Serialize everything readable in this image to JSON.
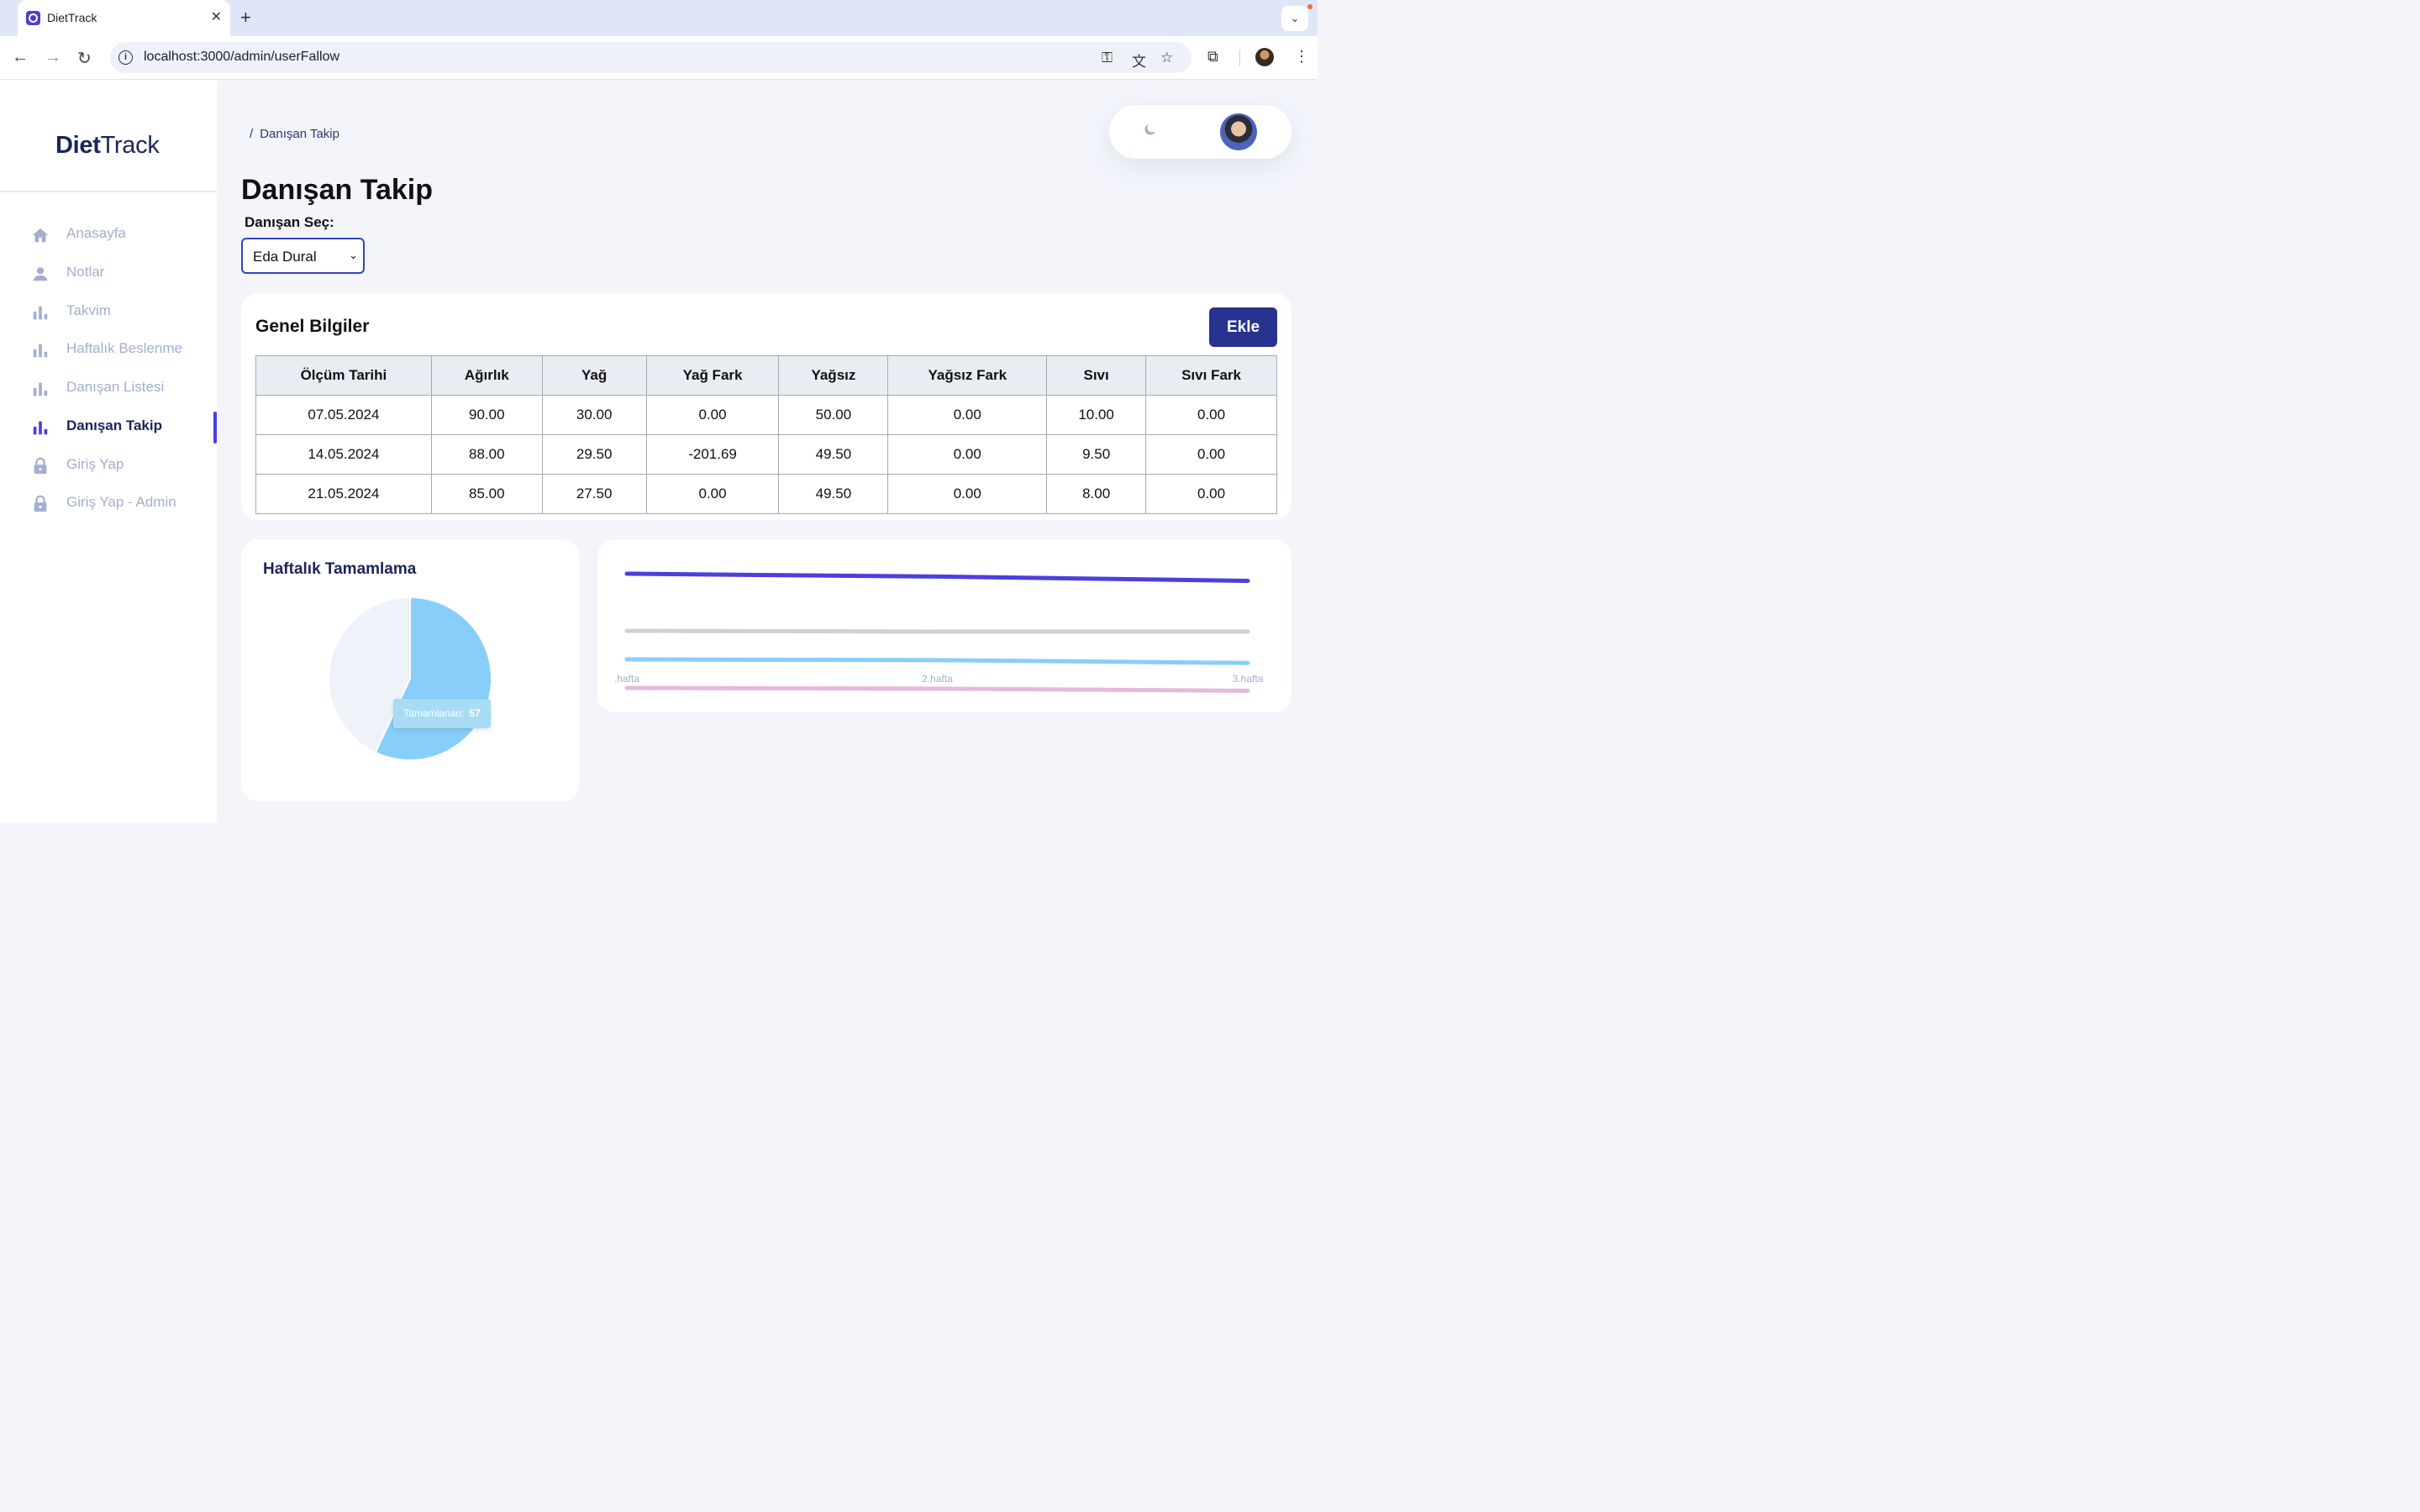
{
  "browser": {
    "tab_title": "DietTrack",
    "url": "localhost:3000/admin/userFallow"
  },
  "sidebar": {
    "brand_bold": "Diet",
    "brand_light": "Track",
    "items": [
      {
        "label": "Anasayfa",
        "icon": "home-icon"
      },
      {
        "label": "Notlar",
        "icon": "person-icon"
      },
      {
        "label": "Takvim",
        "icon": "bar-chart-icon"
      },
      {
        "label": "Haftalık Beslenme",
        "icon": "bar-chart-icon"
      },
      {
        "label": "Danışan Listesi",
        "icon": "bar-chart-icon"
      },
      {
        "label": "Danışan Takip",
        "icon": "bar-chart-icon",
        "active": true
      },
      {
        "label": "Giriş Yap",
        "icon": "lock-icon"
      },
      {
        "label": "Giriş Yap - Admin",
        "icon": "lock-icon"
      }
    ]
  },
  "header": {
    "breadcrumb": "Danışan Takip",
    "title": "Danışan Takip",
    "select_label": "Danışan Seç:",
    "selected_client": "Eda Dural"
  },
  "general_info": {
    "title": "Genel Bilgiler",
    "add_button": "Ekle",
    "columns": [
      "Ölçüm Tarihi",
      "Ağırlık",
      "Yağ",
      "Yağ Fark",
      "Yağsız",
      "Yağsız Fark",
      "Sıvı",
      "Sıvı Fark"
    ],
    "rows": [
      [
        "07.05.2024",
        "90.00",
        "30.00",
        "0.00",
        "50.00",
        "0.00",
        "10.00",
        "0.00"
      ],
      [
        "14.05.2024",
        "88.00",
        "29.50",
        "-201.69",
        "49.50",
        "0.00",
        "9.50",
        "0.00"
      ],
      [
        "21.05.2024",
        "85.00",
        "27.50",
        "0.00",
        "49.50",
        "0.00",
        "8.00",
        "0.00"
      ]
    ]
  },
  "weekly_completion": {
    "title": "Haftalık Tamamlama",
    "tooltip_label": "Tamamlanan:",
    "tooltip_value": "57"
  },
  "colors": {
    "accent": "#4c3fe0",
    "button": "#27338f",
    "pie_completed": "#87cefa",
    "pie_remaining": "#eef2f9"
  },
  "chart_data": [
    {
      "type": "pie",
      "title": "Haftalık Tamamlama",
      "labels": [
        "Tamamlanan",
        ""
      ],
      "values": [
        57,
        43
      ],
      "colors": [
        "#87cefa",
        "#eef2f9"
      ]
    },
    {
      "type": "line",
      "categories": [
        ".hafta",
        "2.hafta",
        "3.hafta"
      ],
      "ylim": [
        0,
        100
      ],
      "grid": false,
      "series": [
        {
          "color": "#4c3fe0",
          "values": [
            90,
            88,
            85
          ]
        },
        {
          "color": "#d0d0d0",
          "values": [
            50,
            49.5,
            49.5
          ]
        },
        {
          "color": "#87cefa",
          "values": [
            30,
            29.5,
            27.5
          ]
        },
        {
          "color": "#e6b8dc",
          "values": [
            10,
            9.5,
            8
          ]
        }
      ]
    }
  ]
}
